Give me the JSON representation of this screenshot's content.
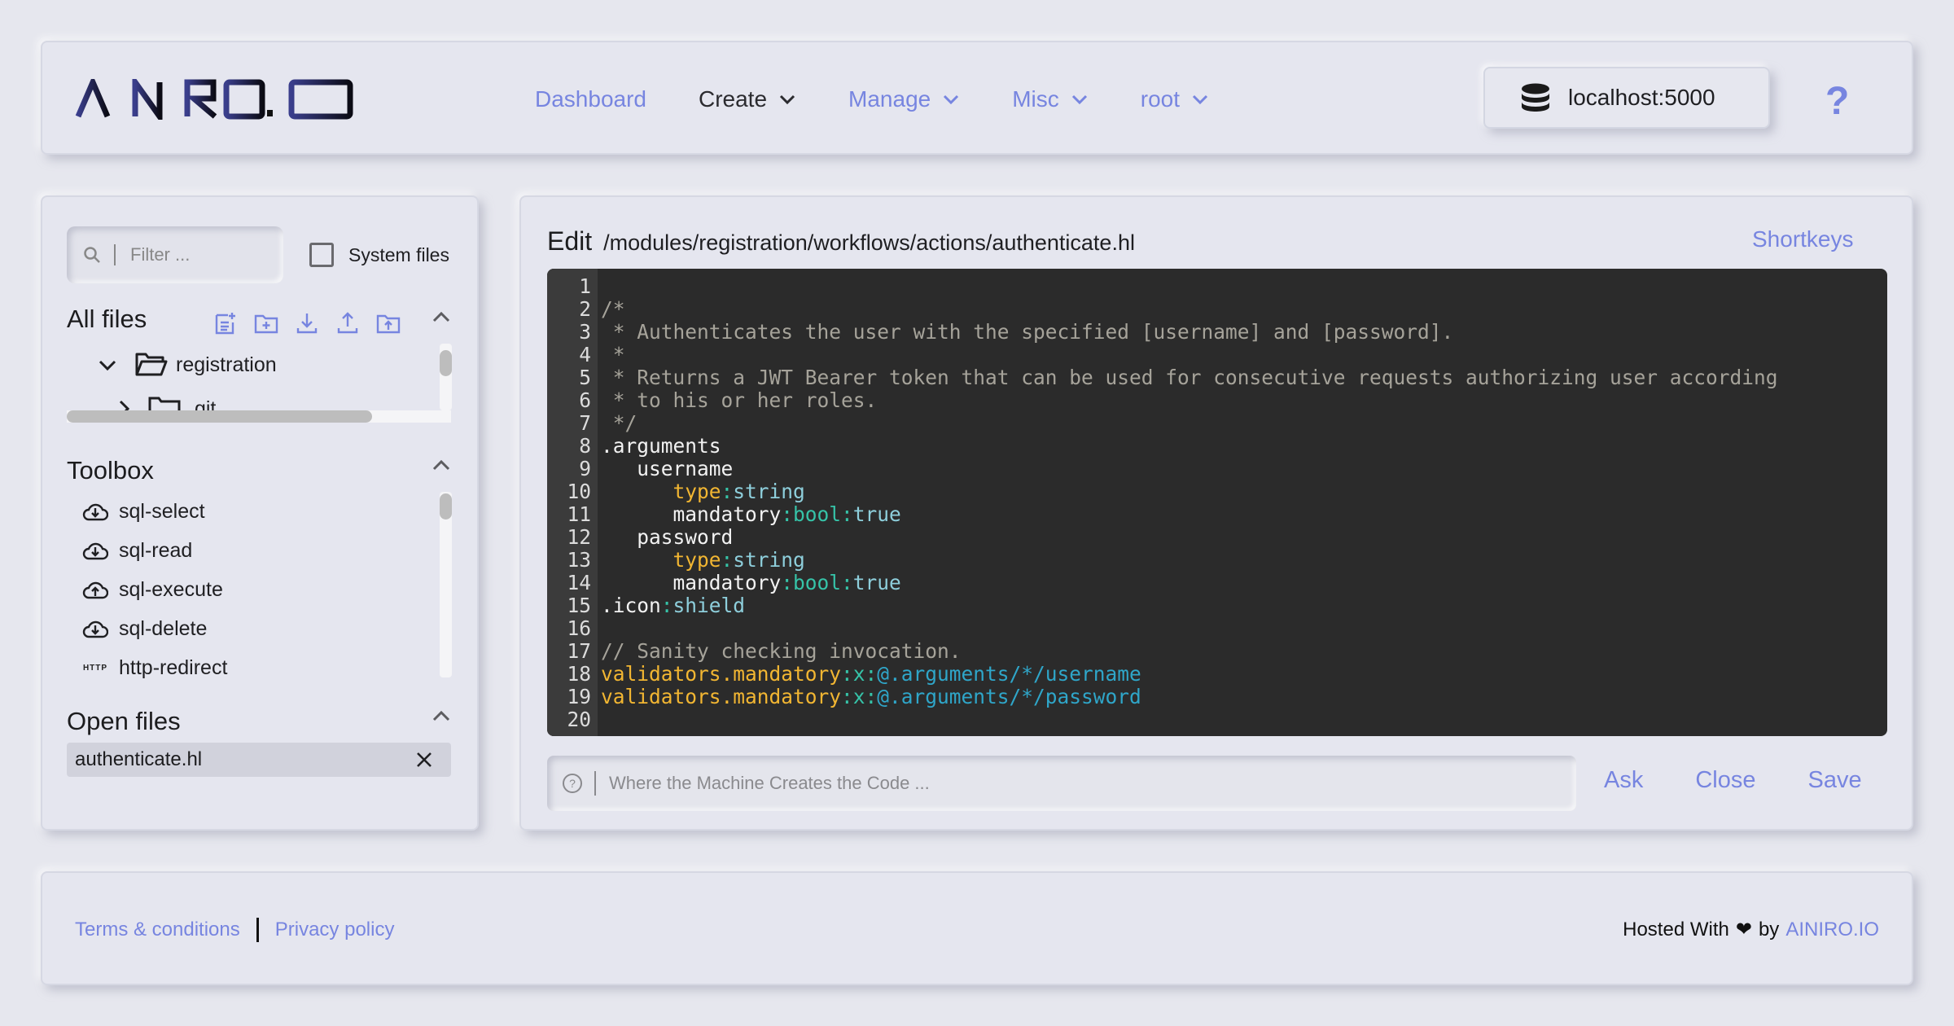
{
  "header": {
    "logo_text": "AINIRO.IO",
    "nav": [
      {
        "label": "Dashboard",
        "has_dropdown": false,
        "active": false
      },
      {
        "label": "Create",
        "has_dropdown": true,
        "active": true
      },
      {
        "label": "Manage",
        "has_dropdown": true,
        "active": false
      },
      {
        "label": "Misc",
        "has_dropdown": true,
        "active": false
      },
      {
        "label": "root",
        "has_dropdown": true,
        "active": false
      }
    ],
    "backend": {
      "icon": "database-icon",
      "label": "localhost:5000"
    },
    "help_label": "?"
  },
  "sidebar": {
    "filter": {
      "placeholder": "Filter ...",
      "value": ""
    },
    "system_files": {
      "label": "System files",
      "checked": false
    },
    "all_files": {
      "title": "All files",
      "tools": [
        "new-file-icon",
        "new-folder-icon",
        "download-icon",
        "upload-icon",
        "upload-folder-icon"
      ],
      "tree": [
        {
          "label": "registration",
          "expanded": true,
          "depth": 0
        },
        {
          "label": ".git",
          "expanded": false,
          "depth": 1
        }
      ]
    },
    "toolbox": {
      "title": "Toolbox",
      "items": [
        {
          "label": "sql-select",
          "icon": "cloud-download-icon"
        },
        {
          "label": "sql-read",
          "icon": "cloud-download-icon"
        },
        {
          "label": "sql-execute",
          "icon": "cloud-upload-icon"
        },
        {
          "label": "sql-delete",
          "icon": "cloud-download-icon"
        },
        {
          "label": "http-redirect",
          "icon": "http-icon",
          "icon_text": "HTTP"
        }
      ]
    },
    "open_files": {
      "title": "Open files",
      "items": [
        {
          "label": "authenticate.hl"
        }
      ]
    }
  },
  "editor": {
    "label": "Edit",
    "path": "/modules/registration/workflows/actions/authenticate.hl",
    "shortkeys_label": "Shortkeys",
    "lines": [
      [],
      [
        [
          "comment",
          "/*"
        ]
      ],
      [
        [
          "comment",
          " * Authenticates the user with the specified [username] and [password]."
        ]
      ],
      [
        [
          "comment",
          " *"
        ]
      ],
      [
        [
          "comment",
          " * Returns a JWT Bearer token that can be used for consecutive requests authorizing user according"
        ]
      ],
      [
        [
          "comment",
          " * to his or her roles."
        ]
      ],
      [
        [
          "comment",
          " */"
        ]
      ],
      [
        [
          "plain",
          ".arguments"
        ]
      ],
      [
        [
          "plain",
          "   username"
        ]
      ],
      [
        [
          "plain",
          "      "
        ],
        [
          "key",
          "type"
        ],
        [
          "colon",
          ":"
        ],
        [
          "val",
          "string"
        ]
      ],
      [
        [
          "plain",
          "      mandatory"
        ],
        [
          "colon",
          ":bool:"
        ],
        [
          "val",
          "true"
        ]
      ],
      [
        [
          "plain",
          "   password"
        ]
      ],
      [
        [
          "plain",
          "      "
        ],
        [
          "key",
          "type"
        ],
        [
          "colon",
          ":"
        ],
        [
          "val",
          "string"
        ]
      ],
      [
        [
          "plain",
          "      mandatory"
        ],
        [
          "colon",
          ":bool:"
        ],
        [
          "val",
          "true"
        ]
      ],
      [
        [
          "plain",
          ".icon"
        ],
        [
          "colon",
          ":"
        ],
        [
          "val",
          "shield"
        ]
      ],
      [],
      [
        [
          "comment",
          "// Sanity checking invocation."
        ]
      ],
      [
        [
          "key",
          "validators.mandatory"
        ],
        [
          "colon",
          ":x:"
        ],
        [
          "expr",
          "@.arguments/*/username"
        ]
      ],
      [
        [
          "key",
          "validators.mandatory"
        ],
        [
          "colon",
          ":x:"
        ],
        [
          "expr",
          "@.arguments/*/password"
        ]
      ],
      []
    ],
    "prompt": {
      "placeholder": "Where the Machine Creates the Code ...",
      "value": ""
    },
    "actions": {
      "ask": "Ask",
      "close": "Close",
      "save": "Save"
    }
  },
  "footer": {
    "terms": "Terms & conditions",
    "privacy": "Privacy policy",
    "hosted_prefix": "Hosted With",
    "heart": "❤",
    "by": "by",
    "brand": "AINIRO.IO"
  },
  "colors": {
    "accent": "#7785e0",
    "editor_bg": "#2b2b2b",
    "keyword": "#f2b632",
    "type": "#36c3a8",
    "value": "#8ecfdc",
    "expression": "#2fa6c9"
  }
}
